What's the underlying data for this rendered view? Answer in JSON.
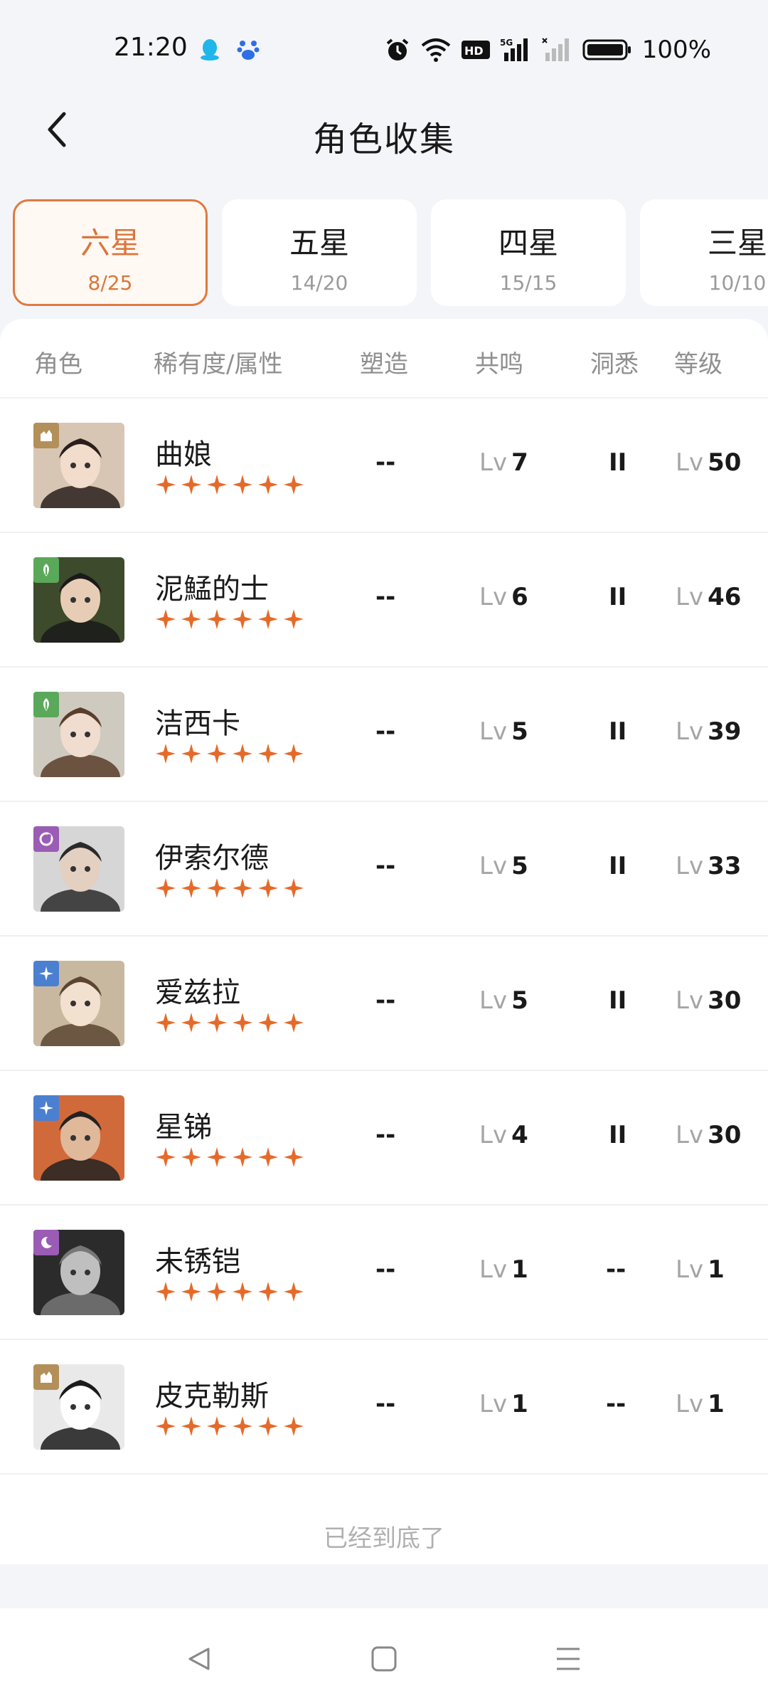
{
  "status_bar": {
    "time": "21:20",
    "battery": "100%",
    "icons": [
      "qq-icon",
      "baidu-icon",
      "alarm-icon",
      "wifi-icon",
      "hd-icon",
      "signal-5g-icon",
      "signal-empty-icon",
      "battery-icon"
    ]
  },
  "header": {
    "title": "角色收集",
    "back_icon": "chevron-left-icon"
  },
  "tabs": [
    {
      "label": "六星",
      "count": "8/25",
      "active": true
    },
    {
      "label": "五星",
      "count": "14/20",
      "active": false
    },
    {
      "label": "四星",
      "count": "15/15",
      "active": false
    },
    {
      "label": "三星",
      "count": "10/10",
      "active": false
    }
  ],
  "columns": {
    "role": "角色",
    "rarity": "稀有度/属性",
    "shaping": "塑造",
    "resonance": "共鸣",
    "insight": "洞悉",
    "level": "等级"
  },
  "lv_prefix": "Lv",
  "characters": [
    {
      "name": "曲娘",
      "stars": 6,
      "attribute": "beast",
      "attr_color": "#b39059",
      "shaping": "--",
      "resonance": "7",
      "insight": "II",
      "level": "50"
    },
    {
      "name": "泥鯭的士",
      "stars": 6,
      "attribute": "plant",
      "attr_color": "#5aa85a",
      "shaping": "--",
      "resonance": "6",
      "insight": "II",
      "level": "46"
    },
    {
      "name": "洁西卡",
      "stars": 6,
      "attribute": "plant",
      "attr_color": "#5aa85a",
      "shaping": "--",
      "resonance": "5",
      "insight": "II",
      "level": "39"
    },
    {
      "name": "伊索尔德",
      "stars": 6,
      "attribute": "spirit",
      "attr_color": "#9a5cb4",
      "shaping": "--",
      "resonance": "5",
      "insight": "II",
      "level": "33"
    },
    {
      "name": "爱兹拉",
      "stars": 6,
      "attribute": "star",
      "attr_color": "#4b7fd0",
      "shaping": "--",
      "resonance": "5",
      "insight": "II",
      "level": "30"
    },
    {
      "name": "星锑",
      "stars": 6,
      "attribute": "star",
      "attr_color": "#4b7fd0",
      "shaping": "--",
      "resonance": "4",
      "insight": "II",
      "level": "30"
    },
    {
      "name": "未锈铠",
      "stars": 6,
      "attribute": "mineral",
      "attr_color": "#9a5cb4",
      "shaping": "--",
      "resonance": "1",
      "insight": "--",
      "level": "1"
    },
    {
      "name": "皮克勒斯",
      "stars": 6,
      "attribute": "beast",
      "attr_color": "#b39059",
      "shaping": "--",
      "resonance": "1",
      "insight": "--",
      "level": "1"
    }
  ],
  "footer": "已经到底了",
  "colors": {
    "accent": "#df7a3f",
    "star": "#e56a2a",
    "background": "#f4f5f9"
  },
  "nav_icons": [
    "nav-back-icon",
    "nav-home-icon",
    "nav-menu-icon"
  ]
}
